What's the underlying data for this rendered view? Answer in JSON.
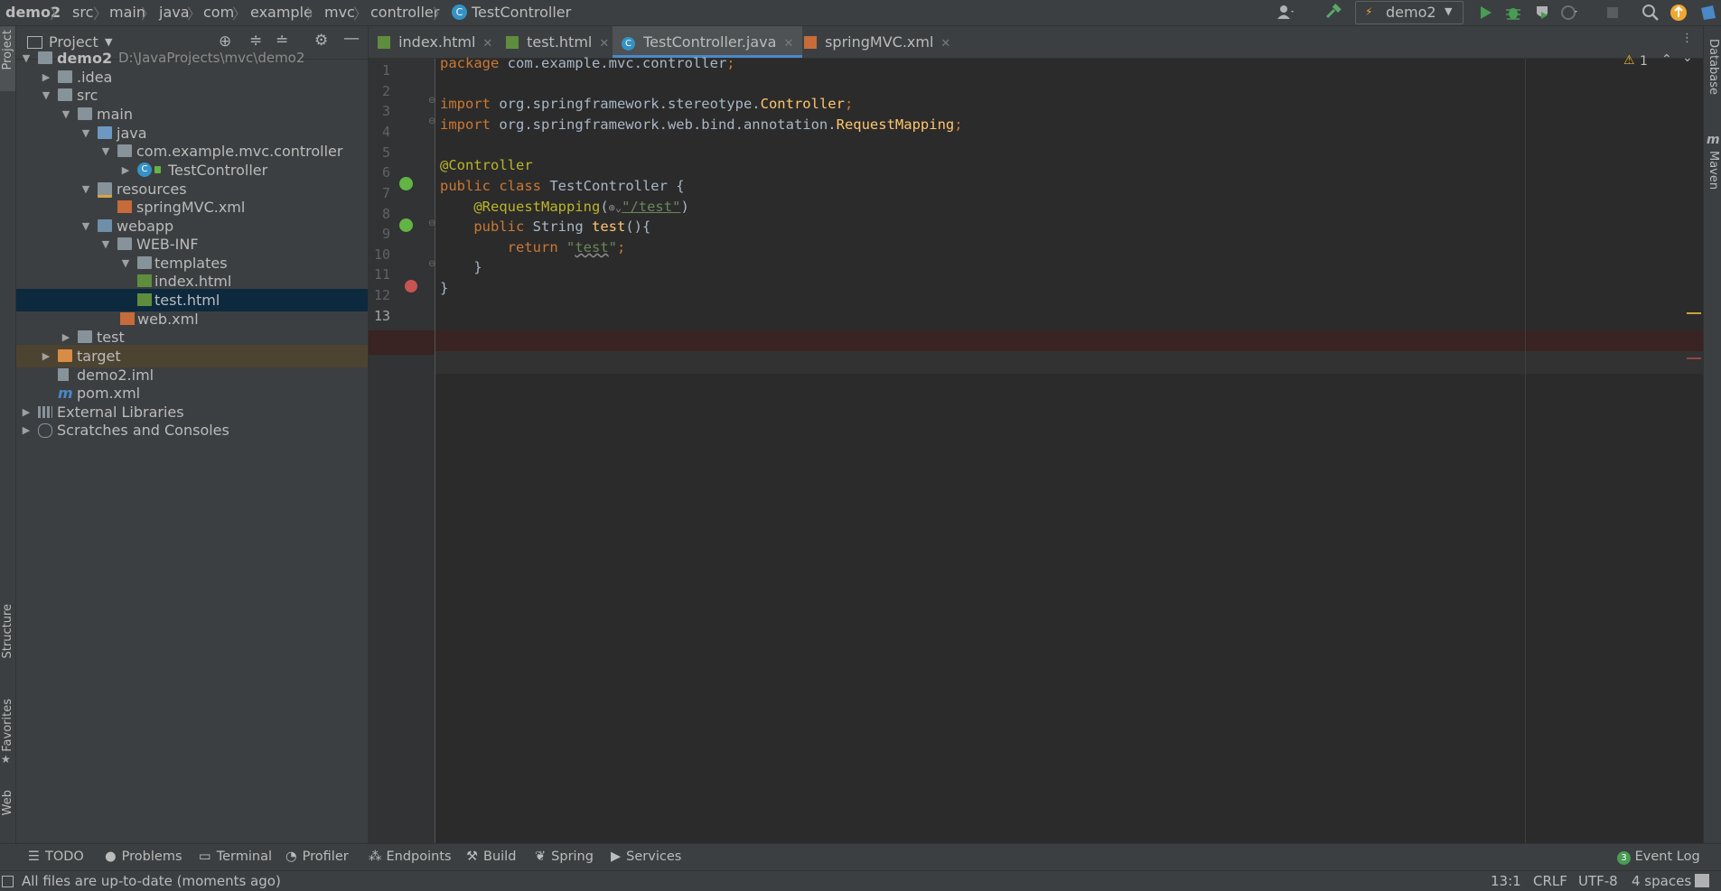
{
  "breadcrumb": [
    "demo2",
    "src",
    "main",
    "java",
    "com",
    "example",
    "mvc",
    "controller",
    "TestController"
  ],
  "toolbar": {
    "run_config": "demo2"
  },
  "project_panel": {
    "title": "Project",
    "tree": [
      {
        "label": "demo2",
        "path": "D:\\JavaProjects\\mvc\\demo2"
      },
      {
        "label": ".idea"
      },
      {
        "label": "src"
      },
      {
        "label": "main"
      },
      {
        "label": "java"
      },
      {
        "label": "com.example.mvc.controller"
      },
      {
        "label": "TestController"
      },
      {
        "label": "resources"
      },
      {
        "label": "springMVC.xml"
      },
      {
        "label": "webapp"
      },
      {
        "label": "WEB-INF"
      },
      {
        "label": "templates"
      },
      {
        "label": "index.html"
      },
      {
        "label": "test.html"
      },
      {
        "label": "web.xml"
      },
      {
        "label": "test"
      },
      {
        "label": "target"
      },
      {
        "label": "demo2.iml"
      },
      {
        "label": "pom.xml"
      },
      {
        "label": "External Libraries"
      },
      {
        "label": "Scratches and Consoles"
      }
    ]
  },
  "tabs": [
    {
      "label": "index.html"
    },
    {
      "label": "test.html"
    },
    {
      "label": "TestController.java"
    },
    {
      "label": "springMVC.xml"
    }
  ],
  "editor": {
    "line_numbers": [
      "1",
      "2",
      "3",
      "4",
      "5",
      "6",
      "7",
      "8",
      "9",
      "10",
      "11",
      "12",
      "13"
    ],
    "lines": [
      "package com.example.mvc.controller;",
      "",
      "import org.springframework.stereotype.Controller;",
      "import org.springframework.web.bind.annotation.RequestMapping;",
      "",
      "@Controller",
      "public class TestController {",
      "    @RequestMapping(\"/test\")",
      "    public String test(){",
      "        return \"test\";",
      "    }",
      "}",
      ""
    ],
    "warnings_count": "1"
  },
  "side_tools": {
    "left": [
      "Project",
      "Structure",
      "Favorites",
      "Web"
    ],
    "right": [
      "Database",
      "Maven"
    ]
  },
  "bottom_tools": [
    "TODO",
    "Problems",
    "Terminal",
    "Profiler",
    "Endpoints",
    "Build",
    "Spring",
    "Services"
  ],
  "event_log": "Event Log",
  "event_log_count": "3",
  "status": {
    "message": "All files are up-to-date (moments ago)",
    "position": "13:1",
    "line_sep": "CRLF",
    "encoding": "UTF-8",
    "indent": "4 spaces"
  },
  "colors": {
    "accent": "#4a88c7",
    "breakpoint": "#c75450",
    "background": "#2b2b2b"
  }
}
